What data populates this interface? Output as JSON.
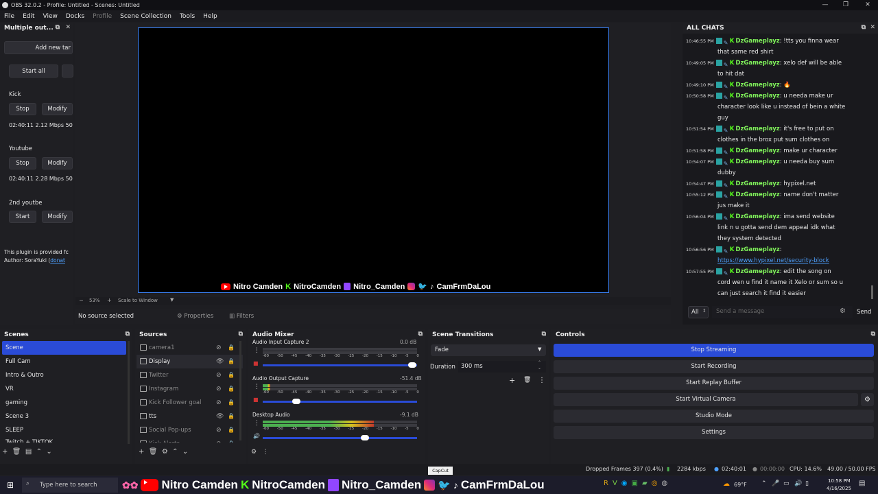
{
  "window": {
    "title": "OBS 32.0.2 - Profile: Untitled - Scenes: Untitled"
  },
  "menu": [
    "File",
    "Edit",
    "View",
    "Docks",
    "Profile",
    "Scene Collection",
    "Tools",
    "Help"
  ],
  "multiple_output": {
    "title": "Multiple out...",
    "add_new_target": "Add new tar",
    "start_all": "Start all",
    "targets": [
      {
        "name": "Kick",
        "btn1": "Stop",
        "btn2": "Modify",
        "stats": "02:40:11  2.12 Mbps  50"
      },
      {
        "name": "Youtube",
        "btn1": "Stop",
        "btn2": "Modify",
        "stats": "02:40:11  2.28 Mbps  50"
      },
      {
        "name": "2nd youtbe",
        "btn1": "Start",
        "btn2": "Modify",
        "stats": ""
      }
    ],
    "plugin_note": "This plugin is provided fc",
    "author": "Author: SoraYuki (",
    "donate": "donat"
  },
  "preview": {
    "zoom": "53%",
    "scale_mode": "Scale to Window",
    "banner": {
      "yt_name": "Nitro Camden",
      "kick_name": "NitroCamden",
      "twitch_name": "Nitro_Camden",
      "social_name": "CamFrmDaLou"
    }
  },
  "source_toolbar": {
    "no_source": "No source selected",
    "properties": "Properties",
    "filters": "Filters"
  },
  "chat": {
    "title": "ALL CHATS",
    "messages": [
      {
        "time": "10:46:55 PM",
        "user": "DzGameplayz",
        "text": "!tts you finna wear",
        "cont": [
          "that same red shirt"
        ]
      },
      {
        "time": "10:49:05 PM",
        "user": "DzGameplayz",
        "text": "xelo def will be able",
        "cont": [
          "to hit dat"
        ]
      },
      {
        "time": "10:49:10 PM",
        "user": "DzGameplayz",
        "text": "",
        "cont": []
      },
      {
        "time": "10:50:58 PM",
        "user": "DzGameplayz",
        "text": "u needa make ur",
        "cont": [
          "character look like u instead of bein a white",
          "guy"
        ]
      },
      {
        "time": "10:51:54 PM",
        "user": "DzGameplayz",
        "text": "it's free to put on",
        "cont": [
          "clothes in the brox put sum clothes on"
        ]
      },
      {
        "time": "10:51:58 PM",
        "user": "DzGameplayz",
        "text": "make ur character",
        "cont": []
      },
      {
        "time": "10:54:07 PM",
        "user": "DzGameplayz",
        "text": "u needa buy sum",
        "cont": [
          "dubby"
        ]
      },
      {
        "time": "10:54:47 PM",
        "user": "DzGameplayz",
        "text": "hypixel.net",
        "cont": []
      },
      {
        "time": "10:55:12 PM",
        "user": "DzGameplayz",
        "text": "name don't matter",
        "cont": [
          "jus make it"
        ]
      },
      {
        "time": "10:56:04 PM",
        "user": "DzGameplayz",
        "text": "ima send website",
        "cont": [
          "link n u gotta send dem appeal idk what",
          "they system detected"
        ]
      },
      {
        "time": "10:56:56 PM",
        "user": "DzGameplayz",
        "text": "",
        "cont": [],
        "link": "https://www.hypixel.net/security-block"
      },
      {
        "time": "10:57:55 PM",
        "user": "DzGameplayz",
        "text": "edit the song on",
        "cont": [
          "cord wen u find it name it Xelo or sum so u",
          "can just search it find it easier"
        ]
      }
    ],
    "filter": "All",
    "placeholder": "Send a message",
    "send": "Send"
  },
  "scenes": {
    "title": "Scenes",
    "items": [
      "Scene",
      "Full Cam",
      "Intro & Outro",
      "VR",
      "gaming",
      "Scene 3",
      "SLEEP",
      "Twitch + TIKTOK"
    ]
  },
  "sources": {
    "title": "Sources",
    "items": [
      "camera1",
      "Display",
      "Twitter",
      "Instagram",
      "Kick Follower goal",
      "tts",
      "Social Pop-ups",
      "Kick Alerts"
    ]
  },
  "mixer": {
    "title": "Audio Mixer",
    "channels": [
      {
        "name": "Audio Input Capture 2",
        "db": "0.0 dB"
      },
      {
        "name": "Audio Output Capture",
        "db": "-51.4 dB"
      },
      {
        "name": "Desktop Audio",
        "db": "-9.1 dB"
      }
    ],
    "scale": [
      "-60",
      "-50",
      "-45",
      "-40",
      "-35",
      "-30",
      "-25",
      "-20",
      "-15",
      "-10",
      "-5",
      "0"
    ]
  },
  "transitions": {
    "title": "Scene Transitions",
    "type": "Fade",
    "duration_label": "Duration",
    "duration": "300 ms"
  },
  "controls": {
    "title": "Controls",
    "buttons": [
      "Stop Streaming",
      "Start Recording",
      "Start Replay Buffer",
      "Start Virtual Camera",
      "Studio Mode",
      "Settings"
    ]
  },
  "status": {
    "dropped": "Dropped Frames 397 (0.4%)",
    "kbps": "2284 kbps",
    "stream_time": "02:40:01",
    "rec_time": "00:00:00",
    "cpu": "CPU: 14.6%",
    "fps": "49.00 / 50.00 FPS"
  },
  "taskbar": {
    "search": "Type here to search",
    "capcut": "CapCut",
    "temp": "69°F",
    "time": "10:58 PM",
    "date": "4/16/2025",
    "banner_yt": "Nitro Camden",
    "banner_kick": "NitroCamden",
    "banner_twitch": "Nitro_Camden",
    "banner_social": "CamFrmDaLou"
  },
  "colors": {
    "accent": "#2a4bd7",
    "chat_name": "#7ff05a",
    "kick": "#53fc18"
  }
}
